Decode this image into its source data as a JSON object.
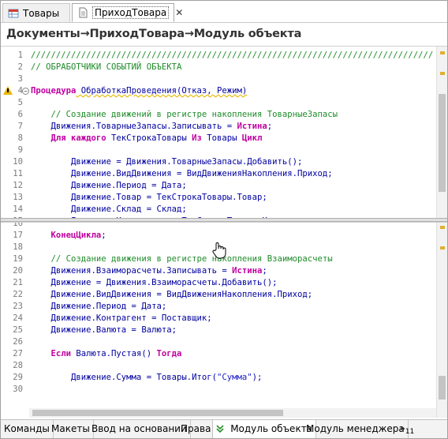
{
  "tabs": [
    {
      "label": "Товары",
      "icon": "table-icon"
    },
    {
      "label": "ПриходТовара",
      "icon": "document-icon",
      "close": "✕"
    }
  ],
  "title": "Документы→ПриходТовара→Модуль объекта",
  "pane1": {
    "lines": [
      {
        "n": "1",
        "parts": [
          [
            "c-comment",
            "////////////////////////////////////////////////////////////////////////////////"
          ]
        ]
      },
      {
        "n": "2",
        "parts": [
          [
            "c-comment",
            "// ОБРАБОТЧИКИ СОБЫТИЙ ОБЪЕКТА"
          ]
        ]
      },
      {
        "n": "3",
        "parts": []
      },
      {
        "n": "4",
        "parts": [
          [
            "c-kw",
            "Процедура"
          ],
          [
            "c-id",
            " ОбработкаПроведения(Отказ, Режим)"
          ]
        ],
        "warn": true,
        "fold": true
      },
      {
        "n": "5",
        "parts": []
      },
      {
        "n": "6",
        "parts": [
          [
            "c-comment",
            "    // Создание движений в регистре накопления ТоварныеЗапасы"
          ]
        ]
      },
      {
        "n": "7",
        "parts": [
          [
            "c-id",
            "    Движения.ТоварныеЗапасы.Записывать = "
          ],
          [
            "c-kw",
            "Истина"
          ],
          [
            "c-id",
            ";"
          ]
        ]
      },
      {
        "n": "8",
        "parts": [
          [
            "c-kw",
            "    Для каждого"
          ],
          [
            "c-id",
            " ТекСтрокаТовары "
          ],
          [
            "c-kw",
            "Из"
          ],
          [
            "c-id",
            " Товары "
          ],
          [
            "c-kw",
            "Цикл"
          ]
        ]
      },
      {
        "n": "9",
        "parts": []
      },
      {
        "n": "10",
        "parts": [
          [
            "c-id",
            "        Движение = Движения.ТоварныеЗапасы.Добавить();"
          ]
        ]
      },
      {
        "n": "11",
        "parts": [
          [
            "c-id",
            "        Движение.ВидДвижения = ВидДвиженияНакопления.Приход;"
          ]
        ]
      },
      {
        "n": "12",
        "parts": [
          [
            "c-id",
            "        Движение.Период = Дата;"
          ]
        ]
      },
      {
        "n": "13",
        "parts": [
          [
            "c-id",
            "        Движение.Товар = ТекСтрокаТовары.Товар;"
          ]
        ]
      },
      {
        "n": "14",
        "parts": [
          [
            "c-id",
            "        Движение.Склад = Склад;"
          ]
        ]
      },
      {
        "n": "15",
        "parts": [
          [
            "c-id",
            "        Движение.Количество = ТекСтрокаТовары.Количество;"
          ]
        ]
      }
    ]
  },
  "pane2": {
    "lines": [
      {
        "n": "16",
        "parts": []
      },
      {
        "n": "17",
        "parts": [
          [
            "c-kw",
            "    КонецЦикла"
          ],
          [
            "c-id",
            ";"
          ]
        ]
      },
      {
        "n": "18",
        "parts": []
      },
      {
        "n": "19",
        "parts": [
          [
            "c-comment",
            "    // Создание движения в регистре накопления Взаиморасчеты"
          ]
        ]
      },
      {
        "n": "20",
        "parts": [
          [
            "c-id",
            "    Движения.Взаиморасчеты.Записывать = "
          ],
          [
            "c-kw",
            "Истина"
          ],
          [
            "c-id",
            ";"
          ]
        ]
      },
      {
        "n": "21",
        "parts": [
          [
            "c-id",
            "    Движение = Движения.Взаиморасчеты.Добавить();"
          ]
        ]
      },
      {
        "n": "22",
        "parts": [
          [
            "c-id",
            "    Движение.ВидДвижения = ВидДвиженияНакопления.Приход;"
          ]
        ]
      },
      {
        "n": "23",
        "parts": [
          [
            "c-id",
            "    Движение.Период = Дата;"
          ]
        ]
      },
      {
        "n": "24",
        "parts": [
          [
            "c-id",
            "    Движение.Контрагент = Поставщик;"
          ]
        ]
      },
      {
        "n": "25",
        "parts": [
          [
            "c-id",
            "    Движение.Валюта = Валюта;"
          ]
        ]
      },
      {
        "n": "26",
        "parts": []
      },
      {
        "n": "27",
        "parts": [
          [
            "c-kw",
            "    Если"
          ],
          [
            "c-id",
            " Валюта.Пустая() "
          ],
          [
            "c-kw",
            "Тогда"
          ]
        ]
      },
      {
        "n": "28",
        "parts": []
      },
      {
        "n": "29",
        "parts": [
          [
            "c-id",
            "        Движение.Сумма = Товары.Итог("
          ],
          [
            "c-str",
            "\"Сумма\""
          ],
          [
            "c-id",
            ");"
          ]
        ]
      },
      {
        "n": "30",
        "parts": []
      }
    ]
  },
  "bottom_tabs": [
    {
      "label": "Команды"
    },
    {
      "label": "Макеты"
    },
    {
      "label": "Ввод на основании"
    },
    {
      "label": "Права"
    },
    {
      "label": "Модуль объекта",
      "active": true,
      "icon": "chevron-double-down-icon"
    },
    {
      "label": "Модуль менеджера"
    }
  ],
  "more_tabs": {
    "symbol": "»",
    "count": "11"
  },
  "colors": {
    "comment": "#1f8c2a",
    "keyword": "#c0009f",
    "identifier": "#0000a0",
    "string": "#1a1acc",
    "warning": "#e8b800"
  }
}
